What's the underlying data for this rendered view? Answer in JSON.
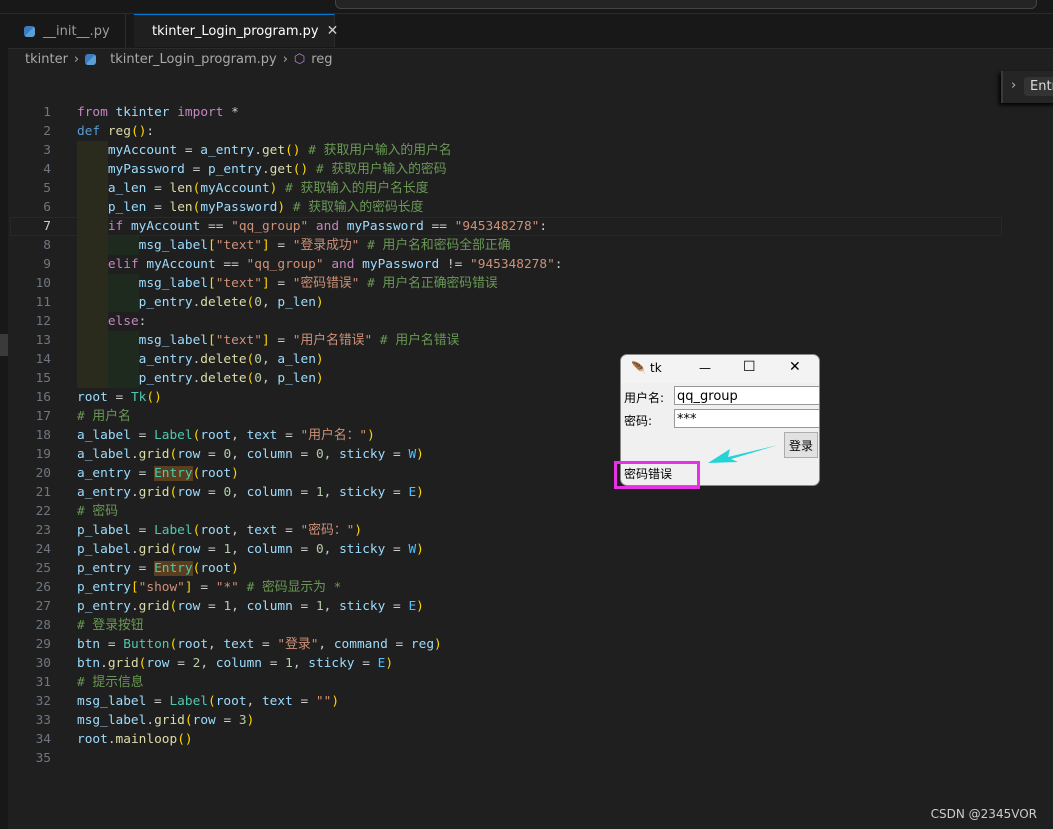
{
  "tabs": [
    {
      "label": "__init__.py",
      "active": false
    },
    {
      "label": "tkinter_Login_program.py",
      "active": true
    }
  ],
  "breadcrumb": {
    "folder": "tkinter",
    "file": "tkinter_Login_program.py",
    "symbol": "reg"
  },
  "sticky_scroll": {
    "label": "Entry"
  },
  "current_line": 7,
  "code": [
    "from tkinter import *",
    "def reg():",
    "    myAccount = a_entry.get() # 获取用户输入的用户名",
    "    myPassword = p_entry.get() # 获取用户输入的密码",
    "    a_len = len(myAccount) # 获取输入的用户名长度",
    "    p_len = len(myPassword) # 获取输入的密码长度",
    "    if myAccount == \"qq_group\" and myPassword == \"945348278\":",
    "        msg_label[\"text\"] = \"登录成功\" # 用户名和密码全部正确",
    "    elif myAccount == \"qq_group\" and myPassword != \"945348278\":",
    "        msg_label[\"text\"] = \"密码错误\" # 用户名正确密码错误",
    "        p_entry.delete(0, p_len)",
    "    else:",
    "        msg_label[\"text\"] = \"用户名错误\" # 用户名错误",
    "        a_entry.delete(0, a_len)",
    "        p_entry.delete(0, p_len)",
    "root = Tk()",
    "# 用户名",
    "a_label = Label(root, text = \"用户名：\")",
    "a_label.grid(row = 0, column = 0, sticky = W)",
    "a_entry = Entry(root)",
    "a_entry.grid(row = 0, column = 1, sticky = E)",
    "# 密码",
    "p_label = Label(root, text = \"密码：\")",
    "p_label.grid(row = 1, column = 0, sticky = W)",
    "p_entry = Entry(root)",
    "p_entry[\"show\"] = \"*\" # 密码显示为 *",
    "p_entry.grid(row = 1, column = 1, sticky = E)",
    "# 登录按钮",
    "btn = Button(root, text = \"登录\", command = reg)",
    "btn.grid(row = 2, column = 1, sticky = E)",
    "# 提示信息",
    "msg_label = Label(root, text = \"\")",
    "msg_label.grid(row = 3)",
    "root.mainloop()",
    ""
  ],
  "tk_window": {
    "title": "tk",
    "username_label": "用户名:",
    "username_value": "qq_group",
    "password_label": "密码:",
    "password_value": "***",
    "login_button": "登录",
    "message": "密码错误"
  },
  "colors": {
    "accent": "#0078d4",
    "arrow": "#22d3d8",
    "highlight_box": "#e830e8"
  },
  "watermark": "CSDN @2345VOR"
}
